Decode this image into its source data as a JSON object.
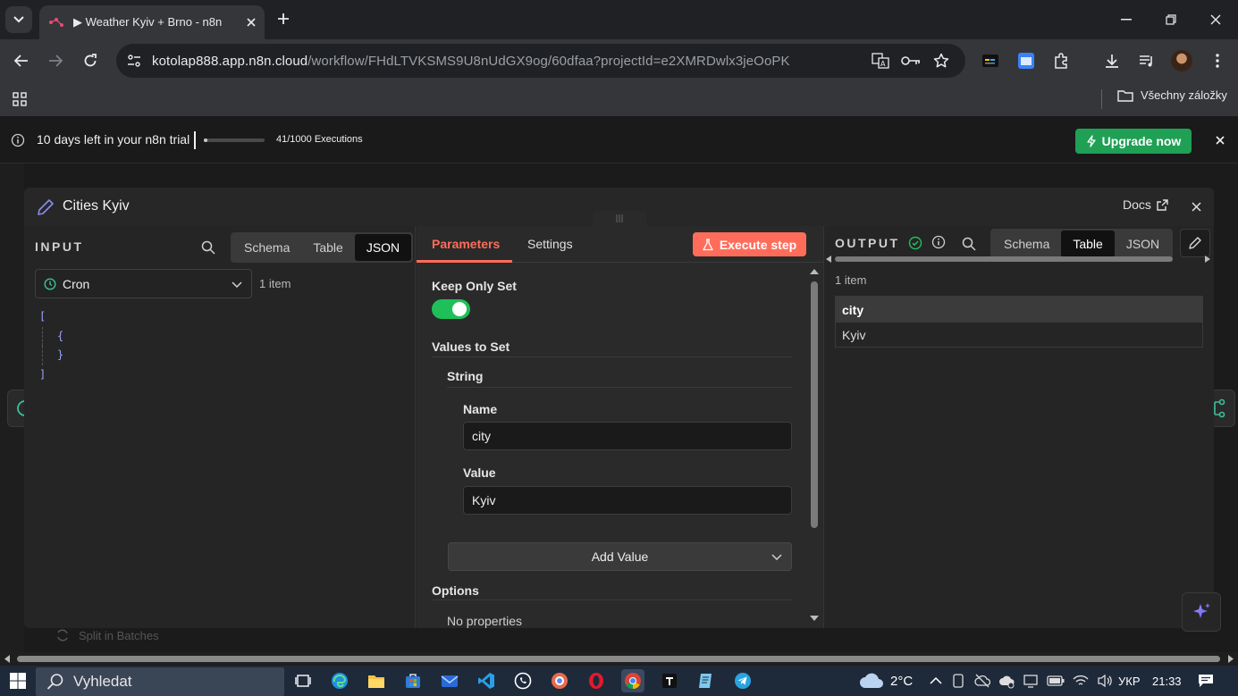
{
  "browser": {
    "tab_title": "▶ Weather Kyiv + Brno - n8n",
    "url_host": "kotolap888.app.n8n.cloud",
    "url_path": "/workflow/FHdLTVKSMS9U8nUdGX9og/60dfaa?projectId=e2XMRDwlx3jeOoPK",
    "bookmarks_label": "Všechny záložky"
  },
  "trial": {
    "message": "10 days left in your n8n trial",
    "executions": "41/1000 Executions",
    "executions_used": 41,
    "executions_total": 1000,
    "upgrade_label": "Upgrade now"
  },
  "modal": {
    "title": "Cities Kyiv",
    "docs_label": "Docs"
  },
  "input": {
    "heading": "INPUT",
    "tabs": [
      "Schema",
      "Table",
      "JSON"
    ],
    "active_tab": "JSON",
    "source_node": "Cron",
    "item_count": "1 item",
    "json_lines": [
      "[",
      "{",
      "}",
      "]"
    ]
  },
  "params": {
    "tabs": [
      "Parameters",
      "Settings"
    ],
    "execute_label": "Execute step",
    "keep_only_set_label": "Keep Only Set",
    "keep_only_set": true,
    "values_to_set_label": "Values to Set",
    "string_label": "String",
    "name_label": "Name",
    "name_value": "city",
    "value_label": "Value",
    "value_value": "Kyiv",
    "add_value_label": "Add Value",
    "options_label": "Options",
    "no_properties": "No properties"
  },
  "output": {
    "heading": "OUTPUT",
    "tabs": [
      "Schema",
      "Table",
      "JSON"
    ],
    "active_tab": "Table",
    "item_count": "1 item",
    "table_header": "city",
    "table_row": "Kyiv"
  },
  "canvas": {
    "bg_node_label": "Split in Batches"
  },
  "taskbar": {
    "search_placeholder": "Vyhledat",
    "weather": "2°C",
    "language": "УКР",
    "time": "21:33"
  },
  "colors": {
    "accent_orange": "#ff6d5a",
    "toggle_green": "#1fbf5a",
    "upgrade_green": "#1fa055",
    "execute_bg": "#ff6d5a"
  }
}
